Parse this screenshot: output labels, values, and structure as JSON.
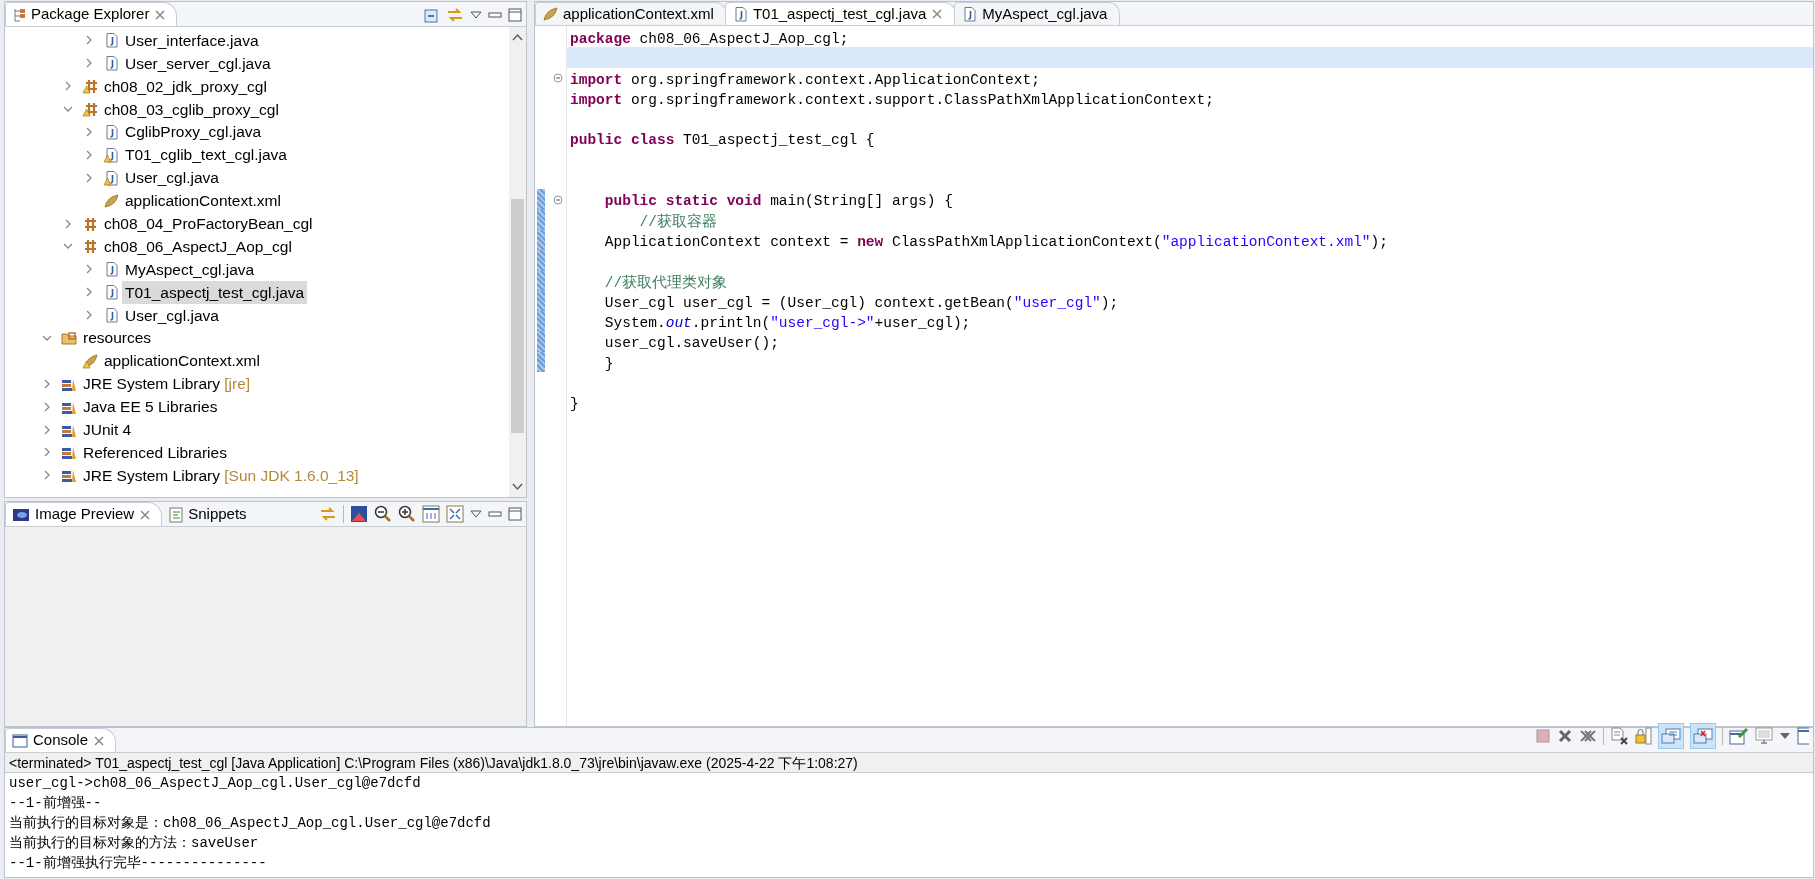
{
  "package_explorer": {
    "title": "Package Explorer",
    "tree": [
      {
        "children": [
          {
            "children": [
              {
                "label": "User_interface.java",
                "kind": "java",
                "expanded": false,
                "selected": false
              },
              {
                "label": "User_server_cgl.java",
                "kind": "java",
                "expanded": false,
                "selected": false
              }
            ]
          },
          {
            "label": "ch08_02_jdk_proxy_cgl",
            "kind": "package-warn",
            "expanded": false,
            "selected": false
          },
          {
            "label": "ch08_03_cglib_proxy_cgl",
            "kind": "package-warn",
            "expanded": true,
            "selected": false,
            "children": [
              {
                "label": "CglibProxy_cgl.java",
                "kind": "java",
                "expanded": false,
                "selected": false
              },
              {
                "label": "T01_cglib_text_cgl.java",
                "kind": "java-warn",
                "expanded": false,
                "selected": false
              },
              {
                "label": "User_cgl.java",
                "kind": "java-warn",
                "expanded": false,
                "selected": false
              },
              {
                "label": "applicationContext.xml",
                "kind": "xml",
                "selected": false
              }
            ]
          },
          {
            "label": "ch08_04_ProFactoryBean_cgl",
            "kind": "package",
            "expanded": false,
            "selected": false
          },
          {
            "label": "ch08_06_AspectJ_Aop_cgl",
            "kind": "package",
            "expanded": true,
            "selected": false,
            "children": [
              {
                "label": "MyAspect_cgl.java",
                "kind": "java",
                "expanded": false,
                "selected": false
              },
              {
                "label": "T01_aspectj_test_cgl.java",
                "kind": "java",
                "expanded": false,
                "selected": true
              },
              {
                "label": "User_cgl.java",
                "kind": "java",
                "expanded": false,
                "selected": false
              }
            ]
          }
        ]
      },
      {
        "label": "resources",
        "kind": "folder",
        "expanded": true,
        "selected": false,
        "children": [
          {
            "label": "applicationContext.xml",
            "kind": "xml-warn",
            "selected": false
          }
        ]
      },
      {
        "label": "JRE System Library",
        "suffix": "[jre]",
        "kind": "library",
        "expanded": false,
        "selected": false
      },
      {
        "label": "Java EE 5 Libraries",
        "kind": "library",
        "expanded": false,
        "selected": false
      },
      {
        "label": "JUnit 4",
        "kind": "library",
        "expanded": false,
        "selected": false
      },
      {
        "label": "Referenced Libraries",
        "kind": "library",
        "expanded": false,
        "selected": false
      },
      {
        "label": "JRE System Library",
        "suffix": "[Sun JDK 1.6.0_13]",
        "kind": "library",
        "expanded": false,
        "selected": false
      }
    ]
  },
  "preview": {
    "tabs": [
      {
        "label": "Image Preview",
        "selected": true
      },
      {
        "label": "Snippets",
        "selected": false
      }
    ]
  },
  "editor": {
    "tabs": [
      {
        "label": "applicationContext.xml",
        "kind": "xml",
        "selected": false
      },
      {
        "label": "T01_aspectj_test_cgl.java",
        "kind": "java",
        "selected": true
      },
      {
        "label": "MyAspect_cgl.java",
        "kind": "java",
        "selected": false
      }
    ],
    "lines": [
      {
        "segments": [
          {
            "kind": "kw",
            "text": "package"
          },
          {
            "kind": "plain",
            "text": " ch08_06_AspectJ_Aop_cgl;"
          }
        ],
        "current": false,
        "fold": false,
        "changed": false
      },
      {
        "current": true,
        "fold": false,
        "changed": false
      },
      {
        "segments": [
          {
            "kind": "kw",
            "text": "import"
          },
          {
            "kind": "plain",
            "text": " org.springframework.context.ApplicationContext;"
          }
        ],
        "current": false,
        "fold": true,
        "changed": false
      },
      {
        "segments": [
          {
            "kind": "kw",
            "text": "import"
          },
          {
            "kind": "plain",
            "text": " org.springframework.context.support.ClassPathXmlApplicationContext;"
          }
        ],
        "current": false,
        "fold": false,
        "changed": false
      },
      {
        "current": false,
        "fold": false,
        "changed": false
      },
      {
        "segments": [
          {
            "kind": "kw",
            "text": "public class"
          },
          {
            "kind": "plain",
            "text": " T01_aspectj_test_cgl {"
          }
        ],
        "current": false,
        "fold": false,
        "changed": false
      },
      {
        "current": false,
        "fold": false,
        "changed": false
      },
      {
        "current": false,
        "fold": false,
        "changed": false
      },
      {
        "segments": [
          {
            "kind": "kw",
            "text": "    public static void"
          },
          {
            "kind": "plain",
            "text": " main(String[] args) {"
          }
        ],
        "current": false,
        "fold": true,
        "changed": true
      },
      {
        "segments": [
          {
            "kind": "comment",
            "text": "        //获取容器"
          }
        ],
        "current": false,
        "fold": false,
        "changed": true
      },
      {
        "segments": [
          {
            "kind": "plain",
            "text": "    ApplicationContext context = "
          },
          {
            "kind": "kw",
            "text": "new"
          },
          {
            "kind": "plain",
            "text": " ClassPathXmlApplicationContext("
          },
          {
            "kind": "str",
            "text": "\"applicationContext.xml\""
          },
          {
            "kind": "plain",
            "text": ");"
          }
        ],
        "current": false,
        "fold": false,
        "changed": true
      },
      {
        "current": false,
        "fold": false,
        "changed": true
      },
      {
        "segments": [
          {
            "kind": "comment",
            "text": "    //获取代理类对象"
          }
        ],
        "current": false,
        "fold": false,
        "changed": true
      },
      {
        "segments": [
          {
            "kind": "plain",
            "text": "    User_cgl user_cgl = (User_cgl) context.getBean("
          },
          {
            "kind": "str",
            "text": "\"user_cgl\""
          },
          {
            "kind": "plain",
            "text": ");"
          }
        ],
        "current": false,
        "fold": false,
        "changed": true
      },
      {
        "segments": [
          {
            "kind": "plain",
            "text": "    System."
          },
          {
            "kind": "static",
            "text": "out"
          },
          {
            "kind": "plain",
            "text": ".println("
          },
          {
            "kind": "str",
            "text": "\"user_cgl->\""
          },
          {
            "kind": "plain",
            "text": "+user_cgl);"
          }
        ],
        "current": false,
        "fold": false,
        "changed": true
      },
      {
        "segments": [
          {
            "kind": "plain",
            "text": "    user_cgl.saveUser();"
          }
        ],
        "current": false,
        "fold": false,
        "changed": true
      },
      {
        "segments": [
          {
            "kind": "plain",
            "text": "    }"
          }
        ],
        "current": false,
        "fold": false,
        "changed": true
      },
      {
        "current": false,
        "fold": false,
        "changed": false
      },
      {
        "segments": [
          {
            "kind": "plain",
            "text": "}"
          }
        ],
        "current": false,
        "fold": false,
        "changed": false
      }
    ]
  },
  "console": {
    "title": "Console",
    "toggles": [
      {
        "kind": "stdout",
        "on": true
      },
      {
        "kind": "stderr",
        "on": true
      }
    ],
    "header": "<terminated> T01_aspectj_test_cgl [Java Application] C:\\Program Files (x86)\\Java\\jdk1.8.0_73\\jre\\bin\\javaw.exe (2025-4-22 下午1:08:27)",
    "output": [
      "user_cgl->ch08_06_AspectJ_Aop_cgl.User_cgl@e7dcfd",
      "--1-前增强--",
      "当前执行的目标对象是：ch08_06_AspectJ_Aop_cgl.User_cgl@e7dcfd",
      "当前执行的目标对象的方法：saveUser",
      "--1-前增强执行完毕---------------"
    ]
  }
}
